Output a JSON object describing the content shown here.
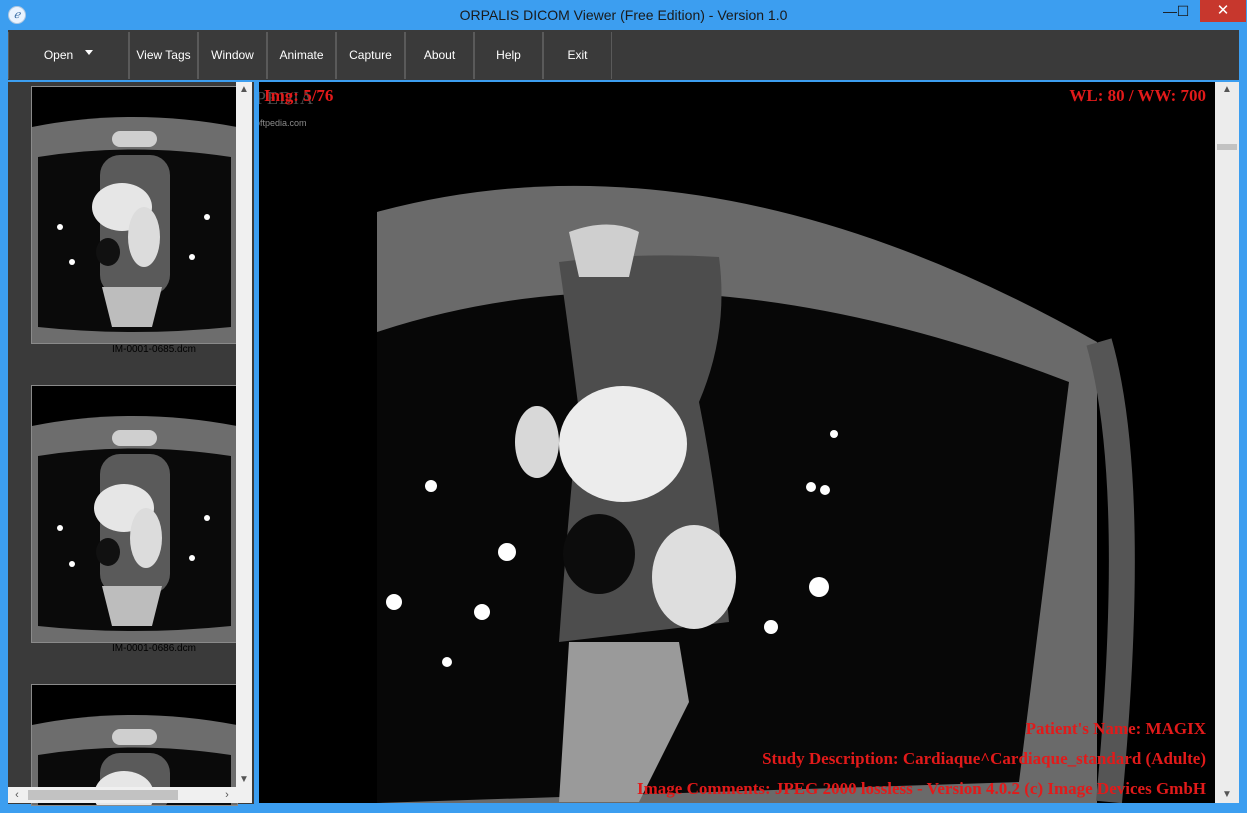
{
  "window": {
    "title": "ORPALIS DICOM Viewer (Free Edition) - Version 1.0",
    "icon": "app-logo-icon",
    "controls": {
      "minimize": "—",
      "maximize": "☐",
      "close": "✕"
    }
  },
  "toolbar": {
    "items": [
      {
        "label": "Open"
      },
      {
        "label": "View Tags"
      },
      {
        "label": "Window"
      },
      {
        "label": "Animate"
      },
      {
        "label": "Capture"
      },
      {
        "label": "About"
      },
      {
        "label": "Help"
      },
      {
        "label": "Exit"
      }
    ]
  },
  "thumbnails": [
    {
      "filename": "IM-0001-0685.dcm"
    },
    {
      "filename": "IM-0001-0686.dcm"
    },
    {
      "filename": ""
    }
  ],
  "viewer": {
    "image_index": "Img: 5/76",
    "window_level": "WL: 80 / WW: 700",
    "patient_name": "Patient's Name: MAGIX",
    "study_description": "Study Description: Cardiaque^Cardiaque_standard (Adulte)",
    "image_comments": "Image Comments: JPEG 2000 lossless - Version 4.0.2 (c) Image Devices GmbH"
  },
  "watermark": {
    "main": "SOFTPEDIA",
    "sub": "www.softpedia.com"
  },
  "colors": {
    "overlay_text": "#e21a1a",
    "toolbar_bg": "#3a3a3a",
    "titlebar_bg": "#3c9ef0",
    "close_button": "#c7372d"
  }
}
